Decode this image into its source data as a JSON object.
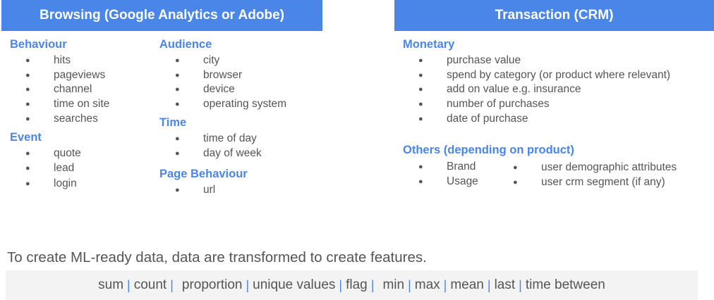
{
  "browsing": {
    "title": "Browsing (Google Analytics or Adobe)",
    "behaviour": {
      "title": "Behaviour",
      "items": [
        "hits",
        "pageviews",
        "channel",
        "time on site",
        "searches"
      ]
    },
    "event": {
      "title": "Event",
      "items": [
        "quote",
        "lead",
        "login"
      ]
    },
    "audience": {
      "title": "Audience",
      "items": [
        "city",
        "browser",
        "device",
        "operating system"
      ]
    },
    "time": {
      "title": "Time",
      "items": [
        "time of day",
        "day of week"
      ]
    },
    "page_behaviour": {
      "title": "Page Behaviour",
      "items": [
        "url"
      ]
    }
  },
  "transaction": {
    "title": "Transaction (CRM)",
    "monetary": {
      "title": "Monetary",
      "items": [
        "purchase value",
        "spend by category (or product where relevant)",
        "add on value e.g. insurance",
        "number of purchases",
        "date of purchase"
      ]
    },
    "others": {
      "title": "Others (depending on product)",
      "col1": [
        "Brand",
        "Usage"
      ],
      "col2": [
        "user demographic attributes",
        "user crm segment (if any)"
      ]
    }
  },
  "footer": {
    "text": "To create ML-ready data, data are transformed to create features.",
    "ops": [
      "sum",
      "count",
      "proportion",
      "unique values",
      "flag",
      "min",
      "max",
      "mean",
      "last",
      "time between"
    ]
  },
  "colors": {
    "accent": "#4a86e8",
    "text": "#555555",
    "ops_bg": "#f3f3f3"
  }
}
